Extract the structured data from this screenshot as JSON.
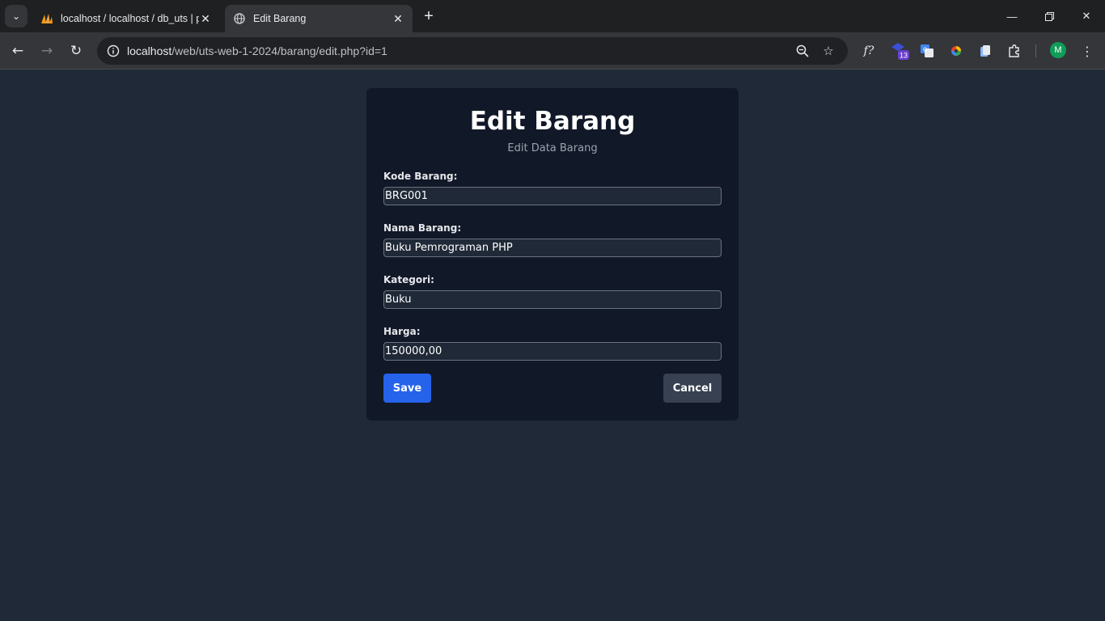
{
  "browser": {
    "tabs": [
      {
        "title": "localhost / localhost / db_uts | p",
        "icon": "phpmyadmin-icon",
        "active": false
      },
      {
        "title": "Edit Barang",
        "icon": "globe-icon",
        "active": true
      }
    ],
    "new_tab_label": "+",
    "url_host": "localhost",
    "url_path": "/web/uts-web-1-2024/barang/edit.php?id=1",
    "extension_badge": "13",
    "profile_initial": "M"
  },
  "card": {
    "title": "Edit Barang",
    "subtitle": "Edit Data Barang",
    "fields": [
      {
        "label": "Kode Barang:",
        "value": "BRG001"
      },
      {
        "label": "Nama Barang:",
        "value": "Buku Pemrograman PHP"
      },
      {
        "label": "Kategori:",
        "value": "Buku"
      },
      {
        "label": "Harga:",
        "value": "150000,00"
      }
    ],
    "save_label": "Save",
    "cancel_label": "Cancel"
  },
  "colors": {
    "page_bg": "#1f2937",
    "card_bg": "#111827",
    "save_bg": "#2563eb",
    "cancel_bg": "#374151"
  }
}
